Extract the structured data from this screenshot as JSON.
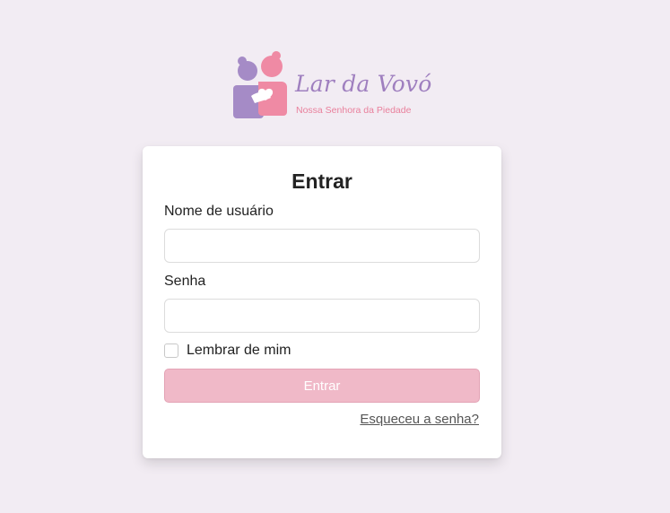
{
  "logo": {
    "title": "Lar da Vovó",
    "subtitle": "Nossa Senhora da Piedade",
    "icon": "family-hug-icon",
    "colors": {
      "purple": "#a58bc6",
      "pink": "#ef8aa4"
    }
  },
  "login": {
    "title": "Entrar",
    "username_label": "Nome de usuário",
    "username_value": "",
    "password_label": "Senha",
    "password_value": "",
    "remember_label": "Lembrar de mim",
    "remember_checked": false,
    "submit_label": "Entrar",
    "forgot_label": "Esqueceu a senha?"
  },
  "colors": {
    "background": "#f2ecf3",
    "button_fill": "#f0b9c8",
    "button_text": "#ffffff"
  }
}
